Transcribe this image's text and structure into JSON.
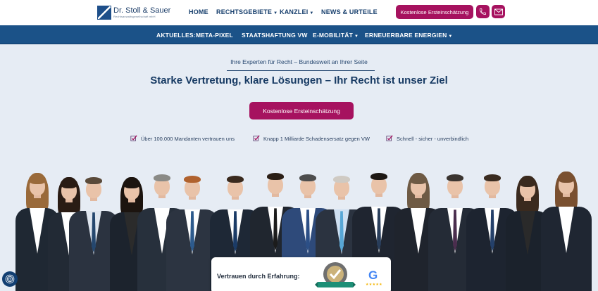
{
  "header": {
    "logo_name": "Dr. Stoll & Sauer",
    "logo_sub": "Rechtsanwaltsgesellschaft mbH",
    "nav": [
      {
        "label": "HOME",
        "has_dropdown": false
      },
      {
        "label": "RECHTSGEBIETE",
        "has_dropdown": true
      },
      {
        "label": "KANZLEI",
        "has_dropdown": true
      },
      {
        "label": "NEWS & URTEILE",
        "has_dropdown": false
      }
    ],
    "cta_label": "Kostenlose Ersteinschätzung",
    "phone_icon": "phone-icon",
    "mail_icon": "mail-icon"
  },
  "subnav": {
    "label": "AKTUELLES:",
    "items": [
      {
        "label": "META-PIXEL",
        "has_dropdown": false
      },
      {
        "label": "STAATSHAFTUNG VW",
        "has_dropdown": false
      },
      {
        "label": "E-MOBILITÄT",
        "has_dropdown": true
      },
      {
        "label": "ERNEUERBARE ENERGIEN",
        "has_dropdown": true
      }
    ]
  },
  "hero": {
    "eyebrow": "Ihre Experten für Recht – Bundesweit an Ihrer Seite",
    "headline": "Starke Vertretung, klare Lösungen – Ihr Recht ist unser Ziel",
    "cta_label": "Kostenlose Ersteinschätzung",
    "usps": [
      "Über 100.000 Mandanten vertrauen uns",
      "Knapp 1 Milliarde Schadensersatz gegen VW",
      "Schnell - sicher - unverbindlich"
    ]
  },
  "trust": {
    "label": "Vertrauen durch Erfahrung:",
    "seal_icon": "recommendation-seal-icon",
    "google_icon": "google-icon"
  },
  "colors": {
    "brand_navy": "#1b5288",
    "accent_magenta": "#a6125f",
    "page_background": "#e6ecf4"
  }
}
